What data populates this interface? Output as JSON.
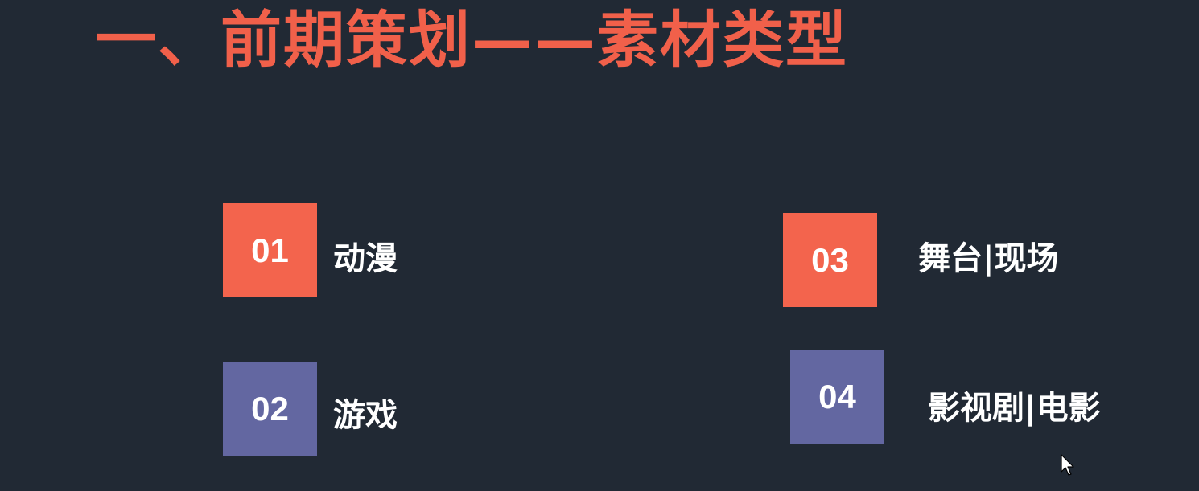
{
  "slide": {
    "title": "一、前期策划——素材类型",
    "items": [
      {
        "number": "01",
        "label": "动漫"
      },
      {
        "number": "02",
        "label": "游戏"
      },
      {
        "number": "03",
        "label": "舞台|现场"
      },
      {
        "number": "04",
        "label": "影视剧|电影"
      }
    ]
  },
  "colors": {
    "background": "#212934",
    "title": "#f1604a",
    "badge_red": "#f3644d",
    "badge_purple": "#6367a1",
    "text": "#ffffff"
  },
  "icons": {
    "cursor": "mouse-pointer-icon"
  }
}
